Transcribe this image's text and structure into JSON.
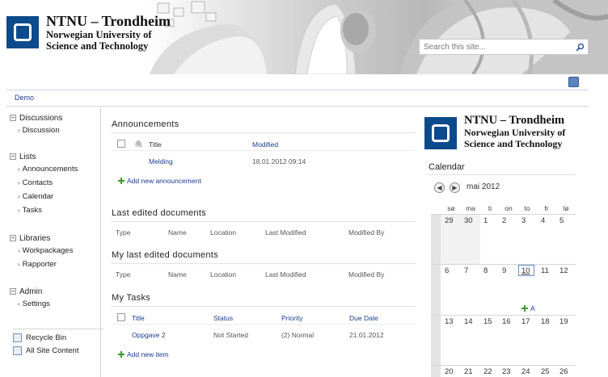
{
  "banner": {
    "logo_line1": "NTNU – Trondheim",
    "logo_line2": "Norwegian University of",
    "logo_line3": "Science and Technology",
    "search_placeholder": "Search this site..."
  },
  "breadcrumb": {
    "home": "Demo"
  },
  "quicklaunch": {
    "groups": [
      {
        "label": "Discussions",
        "items": [
          "Discussion"
        ]
      },
      {
        "label": "Lists",
        "items": [
          "Announcements",
          "Contacts",
          "Calendar",
          "Tasks"
        ]
      },
      {
        "label": "Libraries",
        "items": [
          "Workpackages",
          "Rapporter"
        ]
      },
      {
        "label": "Admin",
        "items": [
          "Settings"
        ]
      }
    ],
    "recycle_bin": "Recycle Bin",
    "all_site_content": "All Site Content"
  },
  "announcements": {
    "title": "Announcements",
    "col_title": "Title",
    "col_modified": "Modified",
    "rows": [
      {
        "title": "Melding",
        "modified": "18.01.2012 09:14"
      }
    ],
    "add_label": "Add new announcement"
  },
  "last_edited": {
    "title": "Last edited documents",
    "cols": [
      "Type",
      "Name",
      "Location",
      "Last Modified",
      "Modified By"
    ]
  },
  "my_last_edited": {
    "title": "My last edited documents",
    "cols": [
      "Type",
      "Name",
      "Location",
      "Last Modified",
      "Modified By"
    ]
  },
  "tasks": {
    "title": "My Tasks",
    "cols": [
      "Title",
      "Status",
      "Priority",
      "Due Date"
    ],
    "rows": [
      {
        "title": "Oppgave 2",
        "status": "Not Started",
        "priority": "(2) Normal",
        "due": "21.01.2012"
      }
    ],
    "add_label": "Add new item"
  },
  "right_logo": {
    "line1": "NTNU – Trondheim",
    "line2": "Norwegian University of",
    "line3": "Science and Technology"
  },
  "calendar": {
    "title": "Calendar",
    "month": "mai 2012",
    "days_of_week": [
      "sø",
      "ma",
      "ti",
      "on",
      "to",
      "fr",
      "lø"
    ],
    "weeks": [
      [
        "29",
        "30",
        "1",
        "2",
        "3",
        "4",
        "5"
      ],
      [
        "6",
        "7",
        "8",
        "9",
        "10",
        "11",
        "12"
      ],
      [
        "13",
        "14",
        "15",
        "16",
        "17",
        "18",
        "19"
      ],
      [
        "20",
        "21",
        "22",
        "23",
        "24",
        "25",
        "26"
      ]
    ],
    "today": "10",
    "event_label": "A"
  }
}
